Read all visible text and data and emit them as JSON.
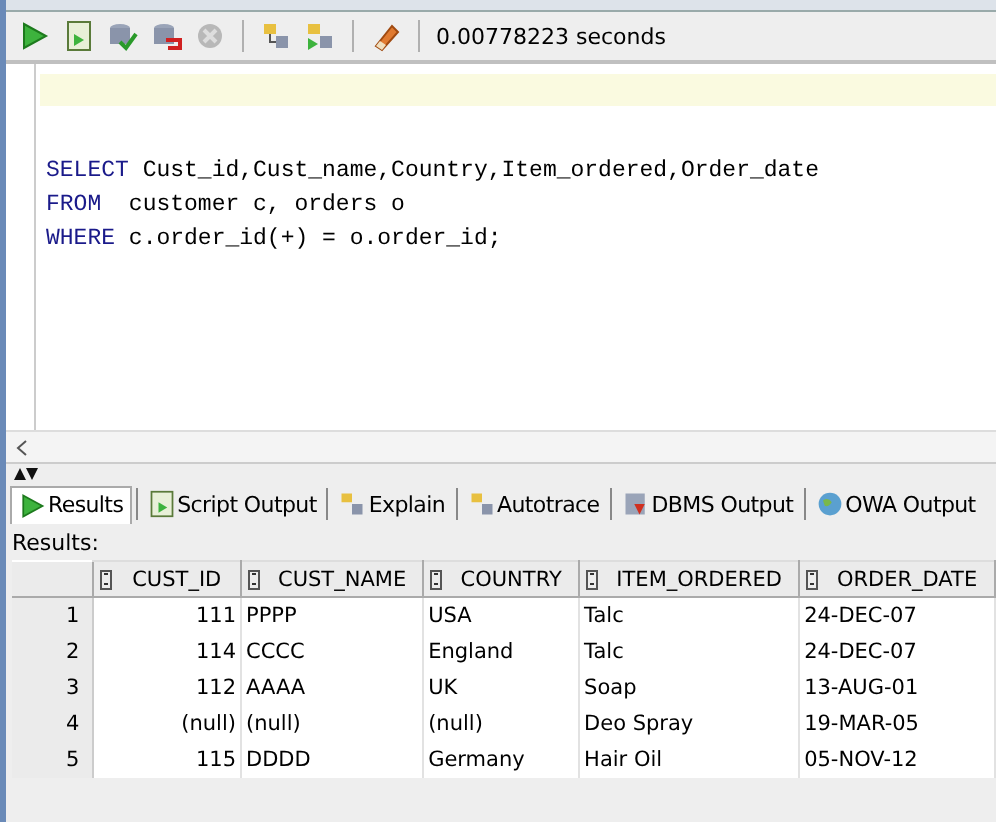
{
  "toolbar": {
    "elapsed": "0.00778223 seconds"
  },
  "editor": {
    "lines": [
      {
        "keyword": "SELECT",
        "text": " Cust_id,Cust_name,Country,Item_ordered,Order_date"
      },
      {
        "keyword": "FROM",
        "text": "  customer c, orders o"
      },
      {
        "keyword": "WHERE",
        "text": " c.order_id(+) = o.order_id;"
      }
    ]
  },
  "tabs": [
    {
      "label": "Results",
      "selected": true
    },
    {
      "label": "Script Output",
      "selected": false
    },
    {
      "label": "Explain",
      "selected": false
    },
    {
      "label": "Autotrace",
      "selected": false
    },
    {
      "label": "DBMS Output",
      "selected": false
    },
    {
      "label": "OWA Output",
      "selected": false
    }
  ],
  "results_label": "Results:",
  "table": {
    "columns": [
      {
        "label": "CUST_ID",
        "kind": "number"
      },
      {
        "label": "CUST_NAME",
        "kind": "text"
      },
      {
        "label": "COUNTRY",
        "kind": "text"
      },
      {
        "label": "ITEM_ORDERED",
        "kind": "text"
      },
      {
        "label": "ORDER_DATE",
        "kind": "text"
      }
    ],
    "rows": [
      {
        "number": "1",
        "cells": [
          "111",
          "PPPP",
          "USA",
          "Talc",
          "24-DEC-07"
        ]
      },
      {
        "number": "2",
        "cells": [
          "114",
          "CCCC",
          "England",
          "Talc",
          "24-DEC-07"
        ]
      },
      {
        "number": "3",
        "cells": [
          "112",
          "AAAA",
          "UK",
          "Soap",
          "13-AUG-01"
        ]
      },
      {
        "number": "4",
        "cells": [
          "(null)",
          "(null)",
          "(null)",
          "Deo Spray",
          "19-MAR-05"
        ]
      },
      {
        "number": "5",
        "cells": [
          "115",
          "DDDD",
          "Germany",
          "Hair Oil",
          "05-NOV-12"
        ]
      }
    ]
  }
}
